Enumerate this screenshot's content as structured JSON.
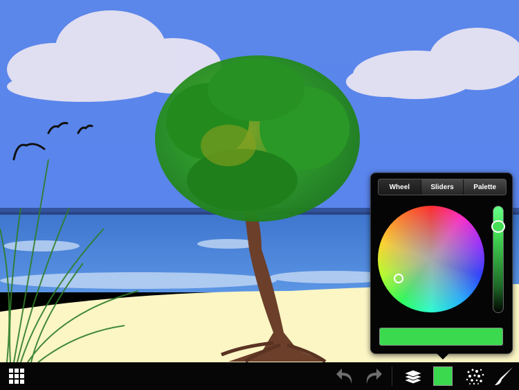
{
  "color_picker": {
    "tabs": [
      {
        "label": "Wheel",
        "active": true
      },
      {
        "label": "Sliders",
        "active": false
      },
      {
        "label": "Palette",
        "active": false
      }
    ],
    "selected_color": "#3ad94e",
    "brightness_level": 0.85
  },
  "toolbar": {
    "icons": [
      "grid-menu-icon",
      "undo-icon",
      "redo-icon",
      "layers-icon",
      "current-color-icon",
      "brush-texture-icon",
      "brush-icon"
    ],
    "current_color": "#3ad94e"
  },
  "canvas": {
    "sky_color": "#5b86ea",
    "sea_color": "#4a82d8",
    "sand_color": "#fbf6c4",
    "foliage_color": "#2c9a22"
  }
}
